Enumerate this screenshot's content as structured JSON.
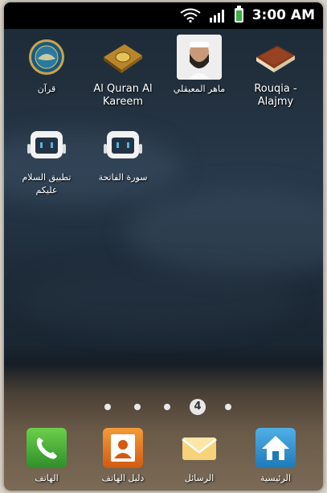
{
  "status": {
    "time": "3:00 AM",
    "battery_level": 1.0
  },
  "apps": [
    {
      "label": "قرآن",
      "icon": "quran-seal-icon"
    },
    {
      "label": "Al Quran Al Kareem",
      "icon": "quran-book-icon"
    },
    {
      "label": "ماهر المعيقلي",
      "icon": "reciter-photo-icon"
    },
    {
      "label": "Rouqia - Alajmy",
      "icon": "brown-book-icon"
    },
    {
      "label": "تطبيق السلام عليكم",
      "icon": "android-app-icon"
    },
    {
      "label": "سورة الفاتحة",
      "icon": "android-app-icon"
    }
  ],
  "pager": {
    "current_page": "4",
    "total_pages": 5
  },
  "dock": [
    {
      "label": "الهاتف",
      "icon": "phone-icon",
      "color": "#3aa63a"
    },
    {
      "label": "دليل الهاتف",
      "icon": "contacts-icon",
      "color": "#e8741e"
    },
    {
      "label": "الرسائل",
      "icon": "messages-icon",
      "color": "#f5c04a"
    },
    {
      "label": "الرئيسية",
      "icon": "home-icon",
      "color": "#2a8fc9"
    }
  ]
}
